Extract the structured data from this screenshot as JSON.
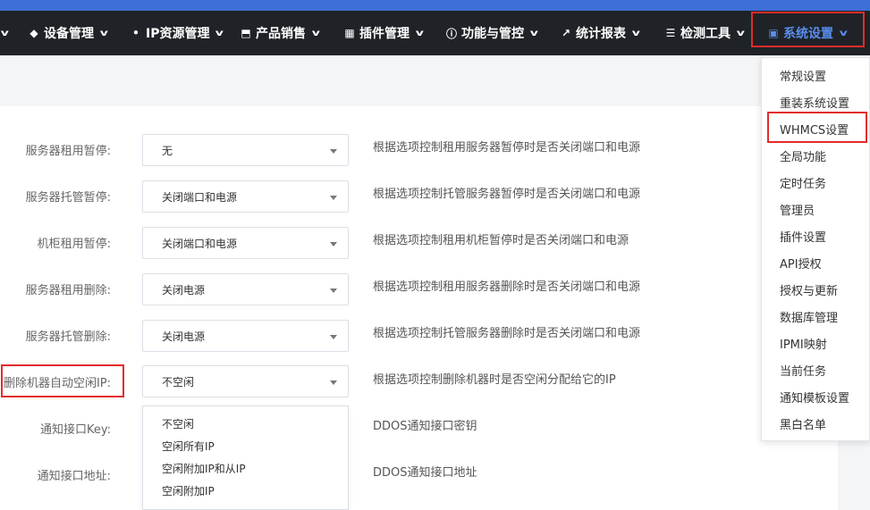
{
  "nav": {
    "items": [
      {
        "label": "设备管理",
        "icon": "cube-icon"
      },
      {
        "label": "IP资源管理",
        "icon": "map-marker-icon"
      },
      {
        "label": "产品销售",
        "icon": "shopping-cart-icon"
      },
      {
        "label": "插件管理",
        "icon": "grid-icon"
      },
      {
        "label": "功能与管控",
        "icon": "info-circle-icon"
      },
      {
        "label": "统计报表",
        "icon": "line-chart-icon"
      },
      {
        "label": "检测工具",
        "icon": "list-icon"
      },
      {
        "label": "系统设置",
        "icon": "windows-icon",
        "active": true
      }
    ]
  },
  "form": {
    "rows": [
      {
        "label": "服务器租用暂停:",
        "value": "无",
        "desc": "根据选项控制租用服务器暂停时是否关闭端口和电源"
      },
      {
        "label": "服务器托管暂停:",
        "value": "关闭端口和电源",
        "desc": "根据选项控制托管服务器暂停时是否关闭端口和电源"
      },
      {
        "label": "机柜租用暂停:",
        "value": "关闭端口和电源",
        "desc": "根据选项控制租用机柜暂停时是否关闭端口和电源"
      },
      {
        "label": "服务器租用删除:",
        "value": "关闭电源",
        "desc": "根据选项控制租用服务器删除时是否关闭端口和电源"
      },
      {
        "label": "服务器托管删除:",
        "value": "关闭电源",
        "desc": "根据选项控制托管服务器删除时是否关闭端口和电源"
      },
      {
        "label": "删除机器自动空闲IP:",
        "value": "不空闲",
        "desc": "根据选项控制删除机器时是否空闲分配给它的IP"
      },
      {
        "label": "通知接口Key:",
        "desc": "DDOS通知接口密钥"
      },
      {
        "label": "通知接口地址:",
        "desc": "DDOS通知接口地址"
      }
    ],
    "dropdown_options": [
      "不空闲",
      "空闲所有IP",
      "空闲附加IP和从IP",
      "空闲附加IP"
    ]
  },
  "system_menu": {
    "items": [
      "常规设置",
      "重装系统设置",
      "WHMCS设置",
      "全局功能",
      "定时任务",
      "管理员",
      "插件设置",
      "API授权",
      "授权与更新",
      "数据库管理",
      "IPMI映射",
      "当前任务",
      "通知模板设置",
      "黑白名单"
    ]
  },
  "colors": {
    "navbar": "#1f2327",
    "accent": "#3d6fd6",
    "active_nav": "#5a8dee",
    "highlight": "#e32b2b"
  }
}
